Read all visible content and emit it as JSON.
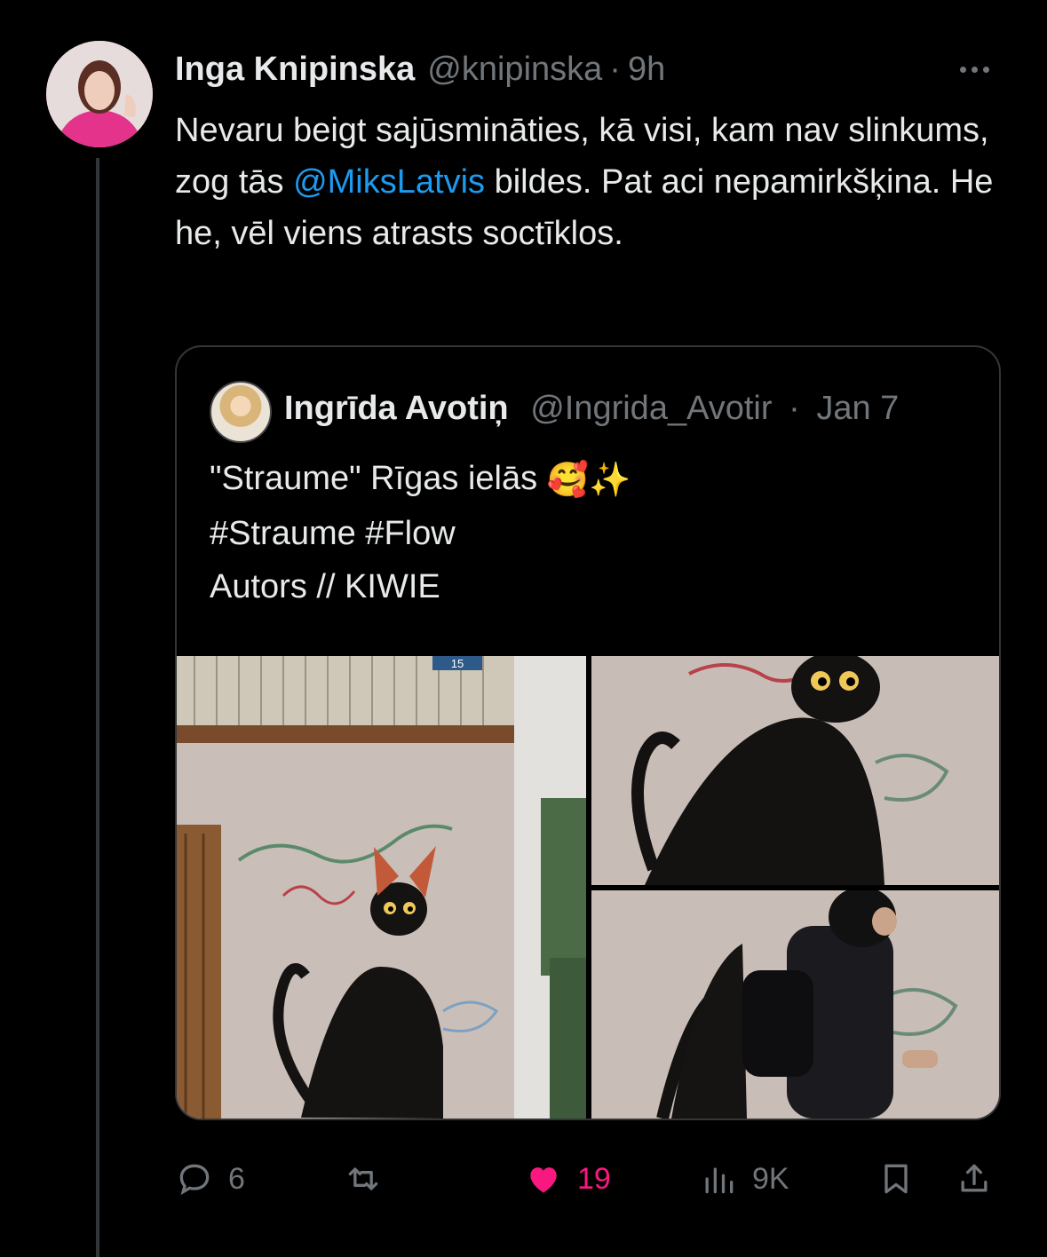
{
  "colors": {
    "accent": "#1d9bf0",
    "like": "#f91880",
    "muted": "#71767b",
    "text": "#e7e9ea",
    "border": "#333639"
  },
  "tweet": {
    "author_name": "Inga Knipinska",
    "handle": "@knipinska",
    "separator": "·",
    "time": "9h",
    "text_before_mention": "Nevaru beigt sajūsmināties, kā visi, kam nav slinkums, zog tās ",
    "mention": "@MiksLatvis",
    "text_after_mention": " bildes. Pat aci nepamirkšķina. He he, vēl viens atrasts soctīklos.",
    "more_icon": "more-horizontal-icon"
  },
  "quote": {
    "author_name": "Ingrīda Avotiņ",
    "handle": "@Ingrida_Avotir",
    "separator": "·",
    "date": "Jan 7",
    "line1": "\"Straume\" Rīgas ielās",
    "line1_emojis": "🥰✨",
    "line2": "#Straume #Flow",
    "line3": "Autors // KIWIE",
    "house_number": "15"
  },
  "actions": {
    "reply": {
      "icon": "reply-icon",
      "count": "6"
    },
    "retweet": {
      "icon": "retweet-icon",
      "count": ""
    },
    "like": {
      "icon": "heart-icon",
      "count": "19"
    },
    "views": {
      "icon": "views-icon",
      "count": "9K"
    },
    "bookmark": {
      "icon": "bookmark-icon"
    },
    "share": {
      "icon": "share-icon"
    }
  }
}
